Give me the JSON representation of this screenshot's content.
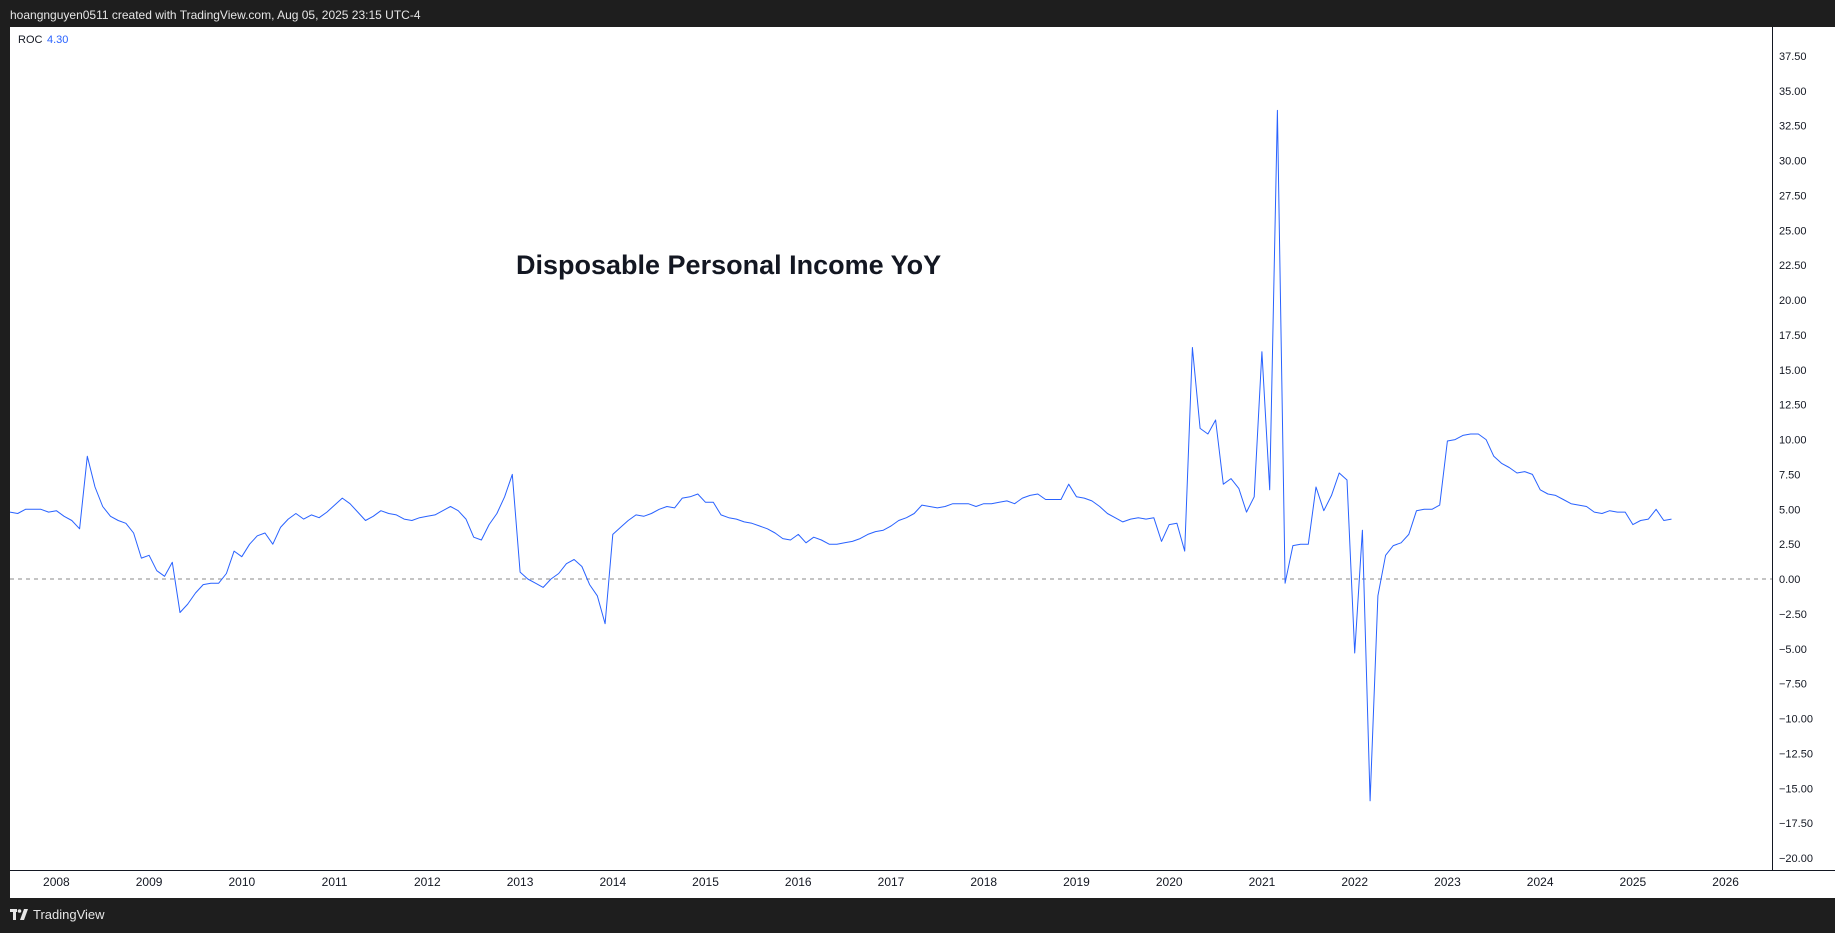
{
  "header": {
    "attribution": "hoangnguyen0511 created with TradingView.com, Aug 05, 2025 23:15 UTC-4"
  },
  "footer": {
    "brand": "TradingView",
    "brand_icon": "tradingview-logo-icon"
  },
  "colors": {
    "line": "#2962ff",
    "background": "#ffffff",
    "frame": "#1e1e1e",
    "zero_line": "#8a8a8a"
  },
  "chart_data": {
    "type": "line",
    "title": "Disposable Personal Income YoY",
    "indicator": {
      "name": "ROC",
      "value": "4.30"
    },
    "xlabel": "",
    "ylabel": "",
    "x_tick_labels": [
      "2008",
      "2009",
      "2010",
      "2011",
      "2012",
      "2013",
      "2014",
      "2015",
      "2016",
      "2017",
      "2018",
      "2019",
      "2020",
      "2021",
      "2022",
      "2023",
      "2024",
      "2025",
      "2026"
    ],
    "y_tick_labels": [
      "37.50",
      "35.00",
      "32.50",
      "30.00",
      "27.50",
      "25.00",
      "22.50",
      "20.00",
      "17.50",
      "15.00",
      "12.50",
      "10.00",
      "7.50",
      "5.00",
      "2.50",
      "0.00",
      "−2.50",
      "−5.00",
      "−7.50",
      "−10.00",
      "−12.50",
      "−15.00",
      "−17.50",
      "−20.00"
    ],
    "ylim": [
      -20,
      37.5
    ],
    "xlim": [
      "2007-07",
      "2026-07"
    ],
    "zero_line": "dashed",
    "grid": false,
    "series": [
      {
        "values": [
          [
            "2007-07",
            4.8
          ],
          [
            "2007-08",
            4.7
          ],
          [
            "2007-09",
            5.0
          ],
          [
            "2007-10",
            5.0
          ],
          [
            "2007-11",
            5.0
          ],
          [
            "2007-12",
            4.8
          ],
          [
            "2008-01",
            4.9
          ],
          [
            "2008-02",
            4.5
          ],
          [
            "2008-03",
            4.2
          ],
          [
            "2008-04",
            3.6
          ],
          [
            "2008-05",
            8.8
          ],
          [
            "2008-06",
            6.6
          ],
          [
            "2008-07",
            5.2
          ],
          [
            "2008-08",
            4.5
          ],
          [
            "2008-09",
            4.2
          ],
          [
            "2008-10",
            4.0
          ],
          [
            "2008-11",
            3.3
          ],
          [
            "2008-12",
            1.5
          ],
          [
            "2009-01",
            1.7
          ],
          [
            "2009-02",
            0.6
          ],
          [
            "2009-03",
            0.2
          ],
          [
            "2009-04",
            1.2
          ],
          [
            "2009-05",
            -2.4
          ],
          [
            "2009-06",
            -1.8
          ],
          [
            "2009-07",
            -1.0
          ],
          [
            "2009-08",
            -0.4
          ],
          [
            "2009-09",
            -0.3
          ],
          [
            "2009-10",
            -0.3
          ],
          [
            "2009-11",
            0.4
          ],
          [
            "2009-12",
            2.0
          ],
          [
            "2010-01",
            1.6
          ],
          [
            "2010-02",
            2.5
          ],
          [
            "2010-03",
            3.1
          ],
          [
            "2010-04",
            3.3
          ],
          [
            "2010-05",
            2.5
          ],
          [
            "2010-06",
            3.7
          ],
          [
            "2010-07",
            4.3
          ],
          [
            "2010-08",
            4.7
          ],
          [
            "2010-09",
            4.3
          ],
          [
            "2010-10",
            4.6
          ],
          [
            "2010-11",
            4.4
          ],
          [
            "2010-12",
            4.8
          ],
          [
            "2011-01",
            5.3
          ],
          [
            "2011-02",
            5.8
          ],
          [
            "2011-03",
            5.4
          ],
          [
            "2011-04",
            4.8
          ],
          [
            "2011-05",
            4.2
          ],
          [
            "2011-06",
            4.5
          ],
          [
            "2011-07",
            4.9
          ],
          [
            "2011-08",
            4.7
          ],
          [
            "2011-09",
            4.6
          ],
          [
            "2011-10",
            4.3
          ],
          [
            "2011-11",
            4.2
          ],
          [
            "2011-12",
            4.4
          ],
          [
            "2012-01",
            4.5
          ],
          [
            "2012-02",
            4.6
          ],
          [
            "2012-03",
            4.9
          ],
          [
            "2012-04",
            5.2
          ],
          [
            "2012-05",
            4.9
          ],
          [
            "2012-06",
            4.3
          ],
          [
            "2012-07",
            3.0
          ],
          [
            "2012-08",
            2.8
          ],
          [
            "2012-09",
            3.9
          ],
          [
            "2012-10",
            4.7
          ],
          [
            "2012-11",
            5.9
          ],
          [
            "2012-12",
            7.5
          ],
          [
            "2013-01",
            0.5
          ],
          [
            "2013-02",
            0.0
          ],
          [
            "2013-03",
            -0.3
          ],
          [
            "2013-04",
            -0.6
          ],
          [
            "2013-05",
            0.0
          ],
          [
            "2013-06",
            0.4
          ],
          [
            "2013-07",
            1.1
          ],
          [
            "2013-08",
            1.4
          ],
          [
            "2013-09",
            0.9
          ],
          [
            "2013-10",
            -0.4
          ],
          [
            "2013-11",
            -1.2
          ],
          [
            "2013-12",
            -3.2
          ],
          [
            "2014-01",
            3.2
          ],
          [
            "2014-02",
            3.7
          ],
          [
            "2014-03",
            4.2
          ],
          [
            "2014-04",
            4.6
          ],
          [
            "2014-05",
            4.5
          ],
          [
            "2014-06",
            4.7
          ],
          [
            "2014-07",
            5.0
          ],
          [
            "2014-08",
            5.2
          ],
          [
            "2014-09",
            5.1
          ],
          [
            "2014-10",
            5.8
          ],
          [
            "2014-11",
            5.9
          ],
          [
            "2014-12",
            6.1
          ],
          [
            "2015-01",
            5.5
          ],
          [
            "2015-02",
            5.5
          ],
          [
            "2015-03",
            4.6
          ],
          [
            "2015-04",
            4.4
          ],
          [
            "2015-05",
            4.3
          ],
          [
            "2015-06",
            4.1
          ],
          [
            "2015-07",
            4.0
          ],
          [
            "2015-08",
            3.8
          ],
          [
            "2015-09",
            3.6
          ],
          [
            "2015-10",
            3.3
          ],
          [
            "2015-11",
            2.9
          ],
          [
            "2015-12",
            2.8
          ],
          [
            "2016-01",
            3.2
          ],
          [
            "2016-02",
            2.6
          ],
          [
            "2016-03",
            3.0
          ],
          [
            "2016-04",
            2.8
          ],
          [
            "2016-05",
            2.5
          ],
          [
            "2016-06",
            2.5
          ],
          [
            "2016-07",
            2.6
          ],
          [
            "2016-08",
            2.7
          ],
          [
            "2016-09",
            2.9
          ],
          [
            "2016-10",
            3.2
          ],
          [
            "2016-11",
            3.4
          ],
          [
            "2016-12",
            3.5
          ],
          [
            "2017-01",
            3.8
          ],
          [
            "2017-02",
            4.2
          ],
          [
            "2017-03",
            4.4
          ],
          [
            "2017-04",
            4.7
          ],
          [
            "2017-05",
            5.3
          ],
          [
            "2017-06",
            5.2
          ],
          [
            "2017-07",
            5.1
          ],
          [
            "2017-08",
            5.2
          ],
          [
            "2017-09",
            5.4
          ],
          [
            "2017-10",
            5.4
          ],
          [
            "2017-11",
            5.4
          ],
          [
            "2017-12",
            5.2
          ],
          [
            "2018-01",
            5.4
          ],
          [
            "2018-02",
            5.4
          ],
          [
            "2018-03",
            5.5
          ],
          [
            "2018-04",
            5.6
          ],
          [
            "2018-05",
            5.4
          ],
          [
            "2018-06",
            5.8
          ],
          [
            "2018-07",
            6.0
          ],
          [
            "2018-08",
            6.1
          ],
          [
            "2018-09",
            5.7
          ],
          [
            "2018-10",
            5.7
          ],
          [
            "2018-11",
            5.7
          ],
          [
            "2018-12",
            6.8
          ],
          [
            "2019-01",
            5.9
          ],
          [
            "2019-02",
            5.8
          ],
          [
            "2019-03",
            5.6
          ],
          [
            "2019-04",
            5.2
          ],
          [
            "2019-05",
            4.7
          ],
          [
            "2019-06",
            4.4
          ],
          [
            "2019-07",
            4.1
          ],
          [
            "2019-08",
            4.3
          ],
          [
            "2019-09",
            4.4
          ],
          [
            "2019-10",
            4.3
          ],
          [
            "2019-11",
            4.4
          ],
          [
            "2019-12",
            2.7
          ],
          [
            "2020-01",
            3.9
          ],
          [
            "2020-02",
            4.0
          ],
          [
            "2020-03",
            2.0
          ],
          [
            "2020-04",
            16.6
          ],
          [
            "2020-05",
            10.8
          ],
          [
            "2020-06",
            10.4
          ],
          [
            "2020-07",
            11.4
          ],
          [
            "2020-08",
            6.8
          ],
          [
            "2020-09",
            7.2
          ],
          [
            "2020-10",
            6.5
          ],
          [
            "2020-11",
            4.8
          ],
          [
            "2020-12",
            5.9
          ],
          [
            "2021-01",
            16.3
          ],
          [
            "2021-02",
            6.4
          ],
          [
            "2021-03",
            33.6
          ],
          [
            "2021-04",
            -0.3
          ],
          [
            "2021-05",
            2.4
          ],
          [
            "2021-06",
            2.5
          ],
          [
            "2021-07",
            2.5
          ],
          [
            "2021-08",
            6.6
          ],
          [
            "2021-09",
            4.9
          ],
          [
            "2021-10",
            6.0
          ],
          [
            "2021-11",
            7.6
          ],
          [
            "2021-12",
            7.1
          ],
          [
            "2022-01",
            -5.3
          ],
          [
            "2022-02",
            3.5
          ],
          [
            "2022-03",
            -15.9
          ],
          [
            "2022-04",
            -1.2
          ],
          [
            "2022-05",
            1.7
          ],
          [
            "2022-06",
            2.4
          ],
          [
            "2022-07",
            2.6
          ],
          [
            "2022-08",
            3.2
          ],
          [
            "2022-09",
            4.9
          ],
          [
            "2022-10",
            5.0
          ],
          [
            "2022-11",
            5.0
          ],
          [
            "2022-12",
            5.3
          ],
          [
            "2023-01",
            9.9
          ],
          [
            "2023-02",
            10.0
          ],
          [
            "2023-03",
            10.3
          ],
          [
            "2023-04",
            10.4
          ],
          [
            "2023-05",
            10.4
          ],
          [
            "2023-06",
            10.0
          ],
          [
            "2023-07",
            8.8
          ],
          [
            "2023-08",
            8.3
          ],
          [
            "2023-09",
            8.0
          ],
          [
            "2023-10",
            7.6
          ],
          [
            "2023-11",
            7.7
          ],
          [
            "2023-12",
            7.5
          ],
          [
            "2024-01",
            6.4
          ],
          [
            "2024-02",
            6.1
          ],
          [
            "2024-03",
            6.0
          ],
          [
            "2024-04",
            5.7
          ],
          [
            "2024-05",
            5.4
          ],
          [
            "2024-06",
            5.3
          ],
          [
            "2024-07",
            5.2
          ],
          [
            "2024-08",
            4.8
          ],
          [
            "2024-09",
            4.7
          ],
          [
            "2024-10",
            4.9
          ],
          [
            "2024-11",
            4.8
          ],
          [
            "2024-12",
            4.8
          ],
          [
            "2025-01",
            3.9
          ],
          [
            "2025-02",
            4.2
          ],
          [
            "2025-03",
            4.3
          ],
          [
            "2025-04",
            5.0
          ],
          [
            "2025-05",
            4.2
          ],
          [
            "2025-06",
            4.3
          ]
        ]
      }
    ]
  }
}
